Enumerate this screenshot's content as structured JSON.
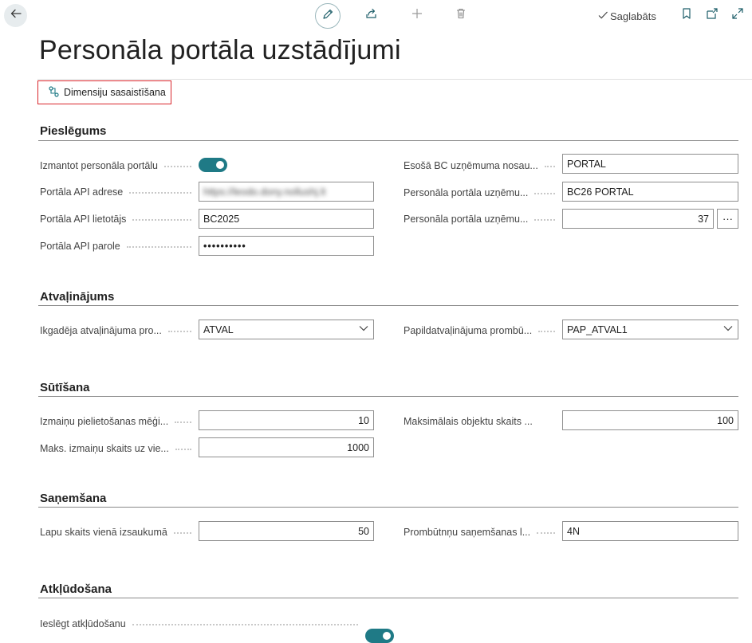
{
  "toolbar": {
    "back_icon": "arrow-left-icon",
    "edit_icon": "pencil-icon",
    "share_icon": "share-icon",
    "new_icon": "plus-icon",
    "delete_icon": "trash-icon",
    "saved_label": "Saglabāts",
    "bookmark_icon": "bookmark-icon",
    "open_new_icon": "open-in-new-window-icon",
    "expand_icon": "expand-icon"
  },
  "page": {
    "title": "Personāla portāla uzstādījumi"
  },
  "actions": {
    "dimension_mapping_label": "Dimensiju sasaistīšana"
  },
  "sections": {
    "connection": {
      "title": "Pieslēgums",
      "use_portal_label": "Izmantot personāla portālu",
      "use_portal_value": true,
      "api_address_label": "Portāla API adrese",
      "api_address_value": "https://leodo.dony.nollushj.lt",
      "api_user_label": "Portāla API lietotājs",
      "api_user_value": "BC2025",
      "api_password_label": "Portāla API parole",
      "api_password_value": "••••••••••",
      "company_name_label": "Esošā BC uzņēmuma nosau...",
      "company_name_value": "PORTAL",
      "portal_company_label": "Personāla portāla uzņēmu...",
      "portal_company_value": "BC26 PORTAL",
      "portal_company_id_label": "Personāla portāla uzņēmu...",
      "portal_company_id_value": "37",
      "more_label": "···"
    },
    "leave": {
      "title": "Atvaļinājums",
      "annual_leave_label": "Ikgadēja atvaļinājuma pro...",
      "annual_leave_value": "ATVAL",
      "extra_leave_label": "Papildatvaļinājuma prombū...",
      "extra_leave_value": "PAP_ATVAL1"
    },
    "sending": {
      "title": "Sūtīšana",
      "retry_label": "Izmaiņu pielietošanas mēģi...",
      "retry_value": "10",
      "max_changes_label": "Maks. izmaiņu skaits uz vie...",
      "max_changes_value": "1000",
      "max_objects_label": "Maksimālais objektu skaits ...",
      "max_objects_value": "100"
    },
    "receiving": {
      "title": "Saņemšana",
      "pages_label": "Lapu skaits vienā izsaukumā",
      "pages_value": "50",
      "absence_label": "Prombūtnņu saņemšanas l...",
      "absence_value": "4N"
    },
    "debugging": {
      "title": "Atkļūdošana",
      "enable_label": "Ieslēgt atkļūdošanu",
      "enable_value": true
    }
  },
  "colors": {
    "accent": "#1f7a86",
    "highlight_border": "#d9262c"
  }
}
